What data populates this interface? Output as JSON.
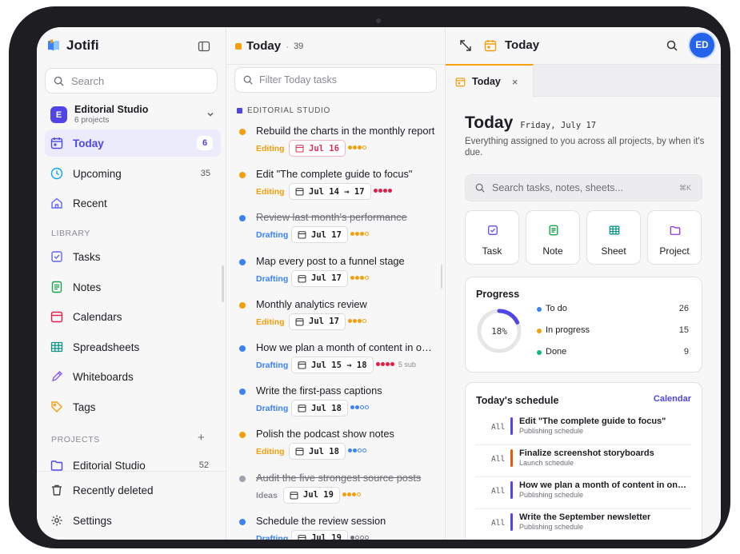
{
  "app": {
    "name": "Jotifi"
  },
  "sidebar": {
    "search_placeholder": "Search",
    "workspace": {
      "badge": "E",
      "name": "Editorial Studio",
      "sub": "6 projects"
    },
    "nav": [
      {
        "label": "Today",
        "count": "6"
      },
      {
        "label": "Upcoming",
        "count": "35"
      },
      {
        "label": "Recent",
        "count": ""
      }
    ],
    "library_label": "LIBRARY",
    "library": [
      {
        "label": "Tasks"
      },
      {
        "label": "Notes"
      },
      {
        "label": "Calendars"
      },
      {
        "label": "Spreadsheets"
      },
      {
        "label": "Whiteboards"
      },
      {
        "label": "Tags"
      }
    ],
    "projects_label": "PROJECTS",
    "projects_add": "+",
    "projects": [
      {
        "label": "Editorial Studio",
        "count": "52"
      }
    ],
    "bottom": [
      {
        "label": "Recently deleted"
      },
      {
        "label": "Settings"
      }
    ]
  },
  "tasklist": {
    "title": "Today",
    "separator": "·",
    "count": "39",
    "filter_placeholder": "Filter Today tasks",
    "group": "EDITORIAL STUDIO",
    "tasks": [
      {
        "title": "Rebuild the charts in the monthly report",
        "status": "Editing",
        "date": "Jul 16",
        "sub": "",
        "done": false,
        "bullet": "#f59e0b",
        "status_color": "#f59e0b",
        "date_red": true,
        "priority": [
          1,
          1,
          1,
          0
        ],
        "priority_color": "#f59e0b"
      },
      {
        "title": "Edit \"The complete guide to focus\"",
        "status": "Editing",
        "date": "Jul 14 → 17",
        "sub": "",
        "done": false,
        "bullet": "#f59e0b",
        "status_color": "#f59e0b",
        "date_red": false,
        "priority": [
          1,
          1,
          1,
          1
        ],
        "priority_color": "#e11d48"
      },
      {
        "title": "Review last month's performance",
        "status": "Drafting",
        "date": "Jul 17",
        "sub": "",
        "done": true,
        "bullet": "#3b82f6",
        "status_color": "#3b82f6",
        "date_red": false,
        "priority": [
          1,
          1,
          1,
          0
        ],
        "priority_color": "#f59e0b"
      },
      {
        "title": "Map every post to a funnel stage",
        "status": "Drafting",
        "date": "Jul 17",
        "sub": "",
        "done": false,
        "bullet": "#3b82f6",
        "status_color": "#3b82f6",
        "date_red": false,
        "priority": [
          1,
          1,
          1,
          0
        ],
        "priority_color": "#f59e0b"
      },
      {
        "title": "Monthly analytics review",
        "status": "Editing",
        "date": "Jul 17",
        "sub": "",
        "done": false,
        "bullet": "#f59e0b",
        "status_color": "#f59e0b",
        "date_red": false,
        "priority": [
          1,
          1,
          1,
          0
        ],
        "priority_color": "#f59e0b"
      },
      {
        "title": "How we plan a month of content in one afternoon",
        "status": "Drafting",
        "date": "Jul 15 → 18",
        "sub": "5 sub",
        "done": false,
        "bullet": "#3b82f6",
        "status_color": "#3b82f6",
        "date_red": false,
        "priority": [
          1,
          1,
          1,
          1
        ],
        "priority_color": "#e11d48"
      },
      {
        "title": "Write the first-pass captions",
        "status": "Drafting",
        "date": "Jul 18",
        "sub": "",
        "done": false,
        "bullet": "#3b82f6",
        "status_color": "#3b82f6",
        "date_red": false,
        "priority": [
          1,
          1,
          0,
          0
        ],
        "priority_color": "#3b82f6"
      },
      {
        "title": "Polish the podcast show notes",
        "status": "Editing",
        "date": "Jul 18",
        "sub": "",
        "done": false,
        "bullet": "#f59e0b",
        "status_color": "#f59e0b",
        "date_red": false,
        "priority": [
          1,
          1,
          0,
          0
        ],
        "priority_color": "#3b82f6"
      },
      {
        "title": "Audit the five strongest source posts",
        "status": "Ideas",
        "date": "Jul 19",
        "sub": "",
        "done": true,
        "bullet": "#9ca3af",
        "status_color": "#8a8a93",
        "date_red": false,
        "priority": [
          1,
          1,
          1,
          0
        ],
        "priority_color": "#f59e0b"
      },
      {
        "title": "Schedule the review session",
        "status": "Drafting",
        "date": "Jul 19",
        "sub": "",
        "done": false,
        "bullet": "#3b82f6",
        "status_color": "#3b82f6",
        "date_red": false,
        "priority": [
          1,
          0,
          0,
          0
        ],
        "priority_color": "#6b7280"
      }
    ]
  },
  "detail": {
    "title": "Today",
    "tab_label": "Today",
    "tab_close": "×",
    "avatar": "ED",
    "heading": "Today",
    "date": "Friday, July 17",
    "description": "Everything assigned to you across all projects, by when it's due.",
    "search_placeholder": "Search tasks, notes, sheets...",
    "search_shortcut": "⌘K",
    "quick_actions": [
      {
        "label": "Task",
        "icon": "checkbox-icon",
        "bg": "#ede9fe",
        "color": "#6d5ce7"
      },
      {
        "label": "Note",
        "icon": "note-icon",
        "bg": "#dcfce7",
        "color": "#16a34a"
      },
      {
        "label": "Sheet",
        "icon": "grid-icon",
        "bg": "#d5f5f0",
        "color": "#0d9488"
      },
      {
        "label": "Project",
        "icon": "folder-icon",
        "bg": "#f1e6fd",
        "color": "#9333ea"
      }
    ],
    "progress": {
      "title": "Progress",
      "percent": "18%",
      "fraction": 0.18,
      "items": [
        {
          "label": "To do",
          "value": "26",
          "color": "#3b82f6"
        },
        {
          "label": "In progress",
          "value": "15",
          "color": "#f59e0b"
        },
        {
          "label": "Done",
          "value": "9",
          "color": "#10b981"
        }
      ]
    },
    "schedule": {
      "title": "Today's schedule",
      "calendar_link": "Calendar",
      "items": [
        {
          "tag": "All",
          "title": "Edit \"The complete guide to focus\"",
          "sub": "Publishing schedule",
          "color": "#4f46e5"
        },
        {
          "tag": "All",
          "title": "Finalize screenshot storyboards",
          "sub": "Launch schedule",
          "color": "#ea580c"
        },
        {
          "tag": "All",
          "title": "How we plan a month of content in one afternoon",
          "sub": "Publishing schedule",
          "color": "#4f46e5"
        },
        {
          "tag": "All",
          "title": "Write the September newsletter",
          "sub": "Publishing schedule",
          "color": "#4f46e5"
        }
      ]
    }
  }
}
